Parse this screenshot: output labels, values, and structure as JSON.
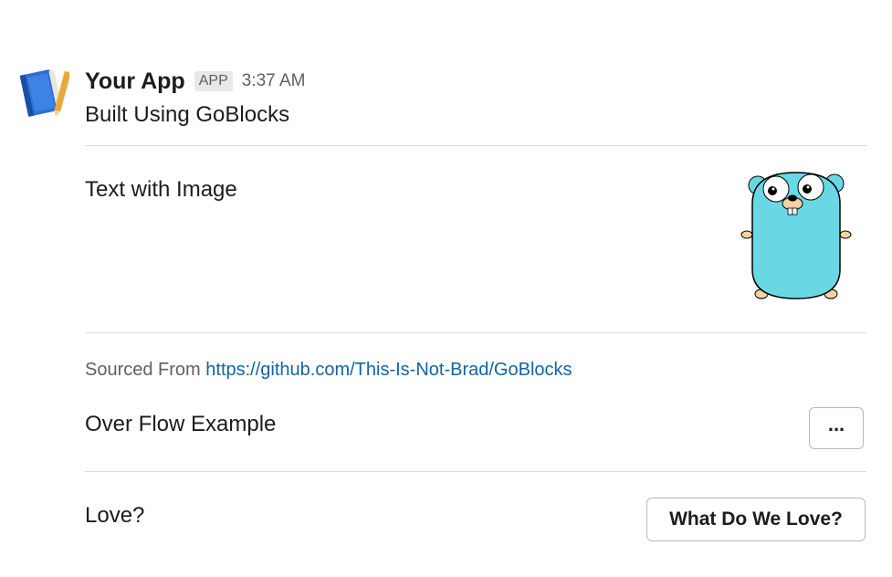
{
  "message": {
    "app_name": "Your App",
    "badge": "APP",
    "timestamp": "3:37 AM",
    "text": "Built Using GoBlocks"
  },
  "section_image": {
    "text": "Text with Image",
    "image_icon": "gopher-image"
  },
  "context": {
    "prefix": "Sourced From ",
    "link": "https://github.com/This-Is-Not-Brad/GoBlocks"
  },
  "overflow_section": {
    "text": "Over Flow Example",
    "button_label": "..."
  },
  "love_section": {
    "text": "Love?",
    "button_label": "What Do We Love?"
  },
  "colors": {
    "link": "#1264a3",
    "gopher": "#6ad7e5"
  }
}
